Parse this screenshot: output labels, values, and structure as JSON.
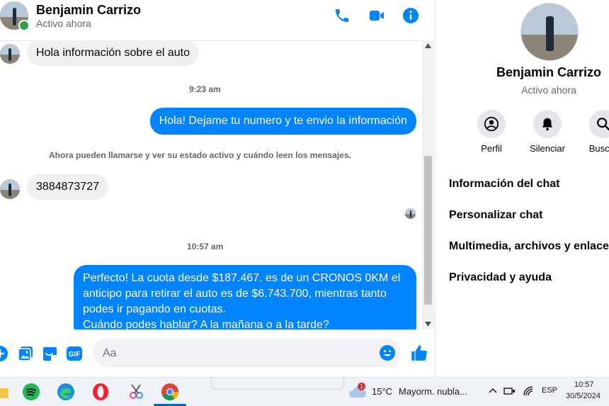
{
  "header": {
    "contact_name": "Benjamin Carrizo",
    "status": "Activo ahora"
  },
  "messages": {
    "in_1": "Hola información sobre el auto",
    "time_1": "9:23 am",
    "out_1": "Hola! Dejame tu numero y te envio la información",
    "system_notice": "Ahora pueden llamarse y ver su estado activo y cuándo leen los mensajes.",
    "in_2": "3884873727",
    "time_2": "10:57 am",
    "out_2_lines": [
      "Perfecto! La cuota desde $187.467. es de un CRONOS 0KM el",
      "anticipo para retirar el auto es de $6.743.700, mientras tanto",
      "podes ir pagando en cuotas.",
      "Cuándo podes hablar? A la mañana o a la tarde?"
    ]
  },
  "composer": {
    "placeholder": "Aa"
  },
  "info_panel": {
    "name": "Benjamin Carrizo",
    "status": "Activo ahora",
    "actions": {
      "profile": "Perfil",
      "mute": "Silenciar",
      "search": "Buscar"
    },
    "menu": {
      "chat_info": "Información del chat",
      "customize": "Personalizar chat",
      "media": "Multimedia, archivos y enlaces",
      "privacy": "Privacidad y ayuda"
    }
  },
  "taskbar": {
    "weather_badge": "1",
    "temperature": "15°C",
    "weather_text": "Mayorm. nubla...",
    "language": "ESP",
    "time": "10:57",
    "date": "30/5/2024"
  },
  "colors": {
    "accent": "#0084ff",
    "online": "#31a24c",
    "bubble_in": "#f0f0f0"
  }
}
